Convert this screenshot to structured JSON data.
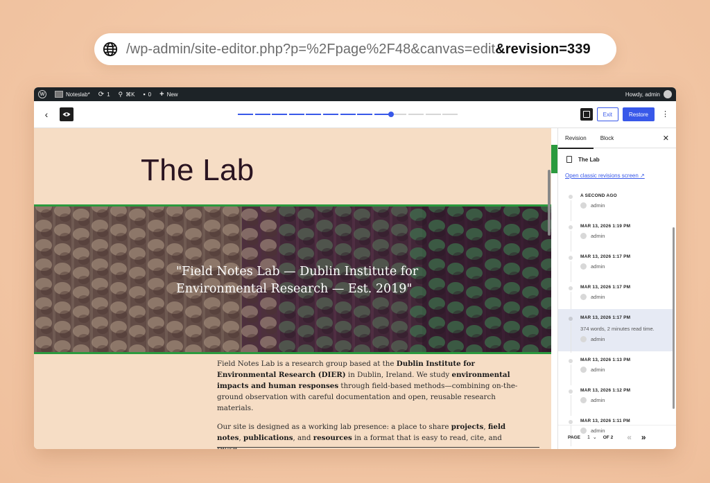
{
  "url": {
    "plain": "/wp-admin/site-editor.php?p=%2Fpage%2F48&canvas=edit",
    "bold": "&revision=339"
  },
  "adminbar": {
    "site_name": "Noteslab*",
    "updates_count": "1",
    "shortcut": "⌘K",
    "comments_count": "0",
    "new_label": "New",
    "howdy": "Howdy, admin"
  },
  "toolbar": {
    "exit_label": "Exit",
    "restore_label": "Restore",
    "timeline_position": 0.68
  },
  "canvas": {
    "page_title": "The Lab",
    "hero_quote": "\"Field Notes Lab — Dublin Institute for Environmental Research — Est. 2019\"",
    "p1": [
      {
        "t": "Field Notes Lab is a research group based at the ",
        "b": false
      },
      {
        "t": "Dublin Institute for Environmental Research (DIER)",
        "b": true
      },
      {
        "t": " in Dublin, Ireland. We study ",
        "b": false
      },
      {
        "t": "environmental impacts and human responses",
        "b": true
      },
      {
        "t": " through field-based methods—combining on-the-ground observation with careful documentation and open, reusable research materials.",
        "b": false
      }
    ],
    "p2": [
      {
        "t": "Our site is designed as a working lab presence: a place to share ",
        "b": false
      },
      {
        "t": "projects",
        "b": true
      },
      {
        "t": ", ",
        "b": false
      },
      {
        "t": "field notes",
        "b": true
      },
      {
        "t": ", ",
        "b": false
      },
      {
        "t": "publications",
        "b": true
      },
      {
        "t": ", and ",
        "b": false
      },
      {
        "t": "resources",
        "b": true
      },
      {
        "t": " in a format that is easy to read, cite, and reuse.",
        "b": false
      }
    ]
  },
  "sidebar": {
    "tab_revision": "Revision",
    "tab_block": "Block",
    "doc_title": "The Lab",
    "classic_link": "Open classic revisions screen ↗",
    "revisions": [
      {
        "date": "A SECOND AGO",
        "user": "admin",
        "selected": false
      },
      {
        "date": "MAR 13, 2026 1:19 PM",
        "user": "admin",
        "selected": false
      },
      {
        "date": "MAR 13, 2026 1:17 PM",
        "user": "admin",
        "selected": false
      },
      {
        "date": "MAR 13, 2026 1:17 PM",
        "user": "admin",
        "selected": false
      },
      {
        "date": "MAR 13, 2026 1:17 PM",
        "words": "374 words, 2 minutes read time.",
        "user": "admin",
        "selected": true
      },
      {
        "date": "MAR 13, 2026 1:13 PM",
        "user": "admin",
        "selected": false
      },
      {
        "date": "MAR 13, 2026 1:12 PM",
        "user": "admin",
        "selected": false
      },
      {
        "date": "MAR 13, 2026 1:11 PM",
        "user": "admin",
        "selected": false
      }
    ],
    "pager": {
      "page_label": "PAGE",
      "page_value": "1",
      "of_label": "OF 2"
    }
  },
  "colors": {
    "accent": "#3858e9",
    "green": "#2b9a3e",
    "canvas_bg": "#f6ddc5"
  }
}
